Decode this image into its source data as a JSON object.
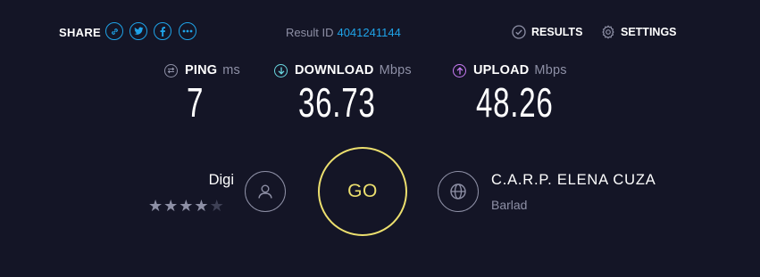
{
  "header": {
    "share_label": "SHARE",
    "share_icons": [
      {
        "icon": "link-icon",
        "glyph": "⛓"
      },
      {
        "icon": "twitter-icon",
        "glyph": "t"
      },
      {
        "icon": "facebook-icon",
        "glyph": "f"
      },
      {
        "icon": "more-icon",
        "glyph": "•••"
      }
    ],
    "result_id_label": "Result ID",
    "result_id_value": "4041241144",
    "results_label": "RESULTS",
    "settings_label": "SETTINGS"
  },
  "metrics": {
    "ping": {
      "label": "PING",
      "unit": "ms",
      "value": "7",
      "icon": "ping-icon"
    },
    "download": {
      "label": "DOWNLOAD",
      "unit": "Mbps",
      "value": "36.73",
      "icon": "download-arrow-icon"
    },
    "upload": {
      "label": "UPLOAD",
      "unit": "Mbps",
      "value": "48.26",
      "icon": "upload-arrow-icon"
    }
  },
  "isp": {
    "name": "Digi",
    "rating": 4,
    "rating_max": 5
  },
  "go_label": "GO",
  "server": {
    "name": "C.A.R.P. ELENA CUZA",
    "location": "Barlad"
  },
  "colors": {
    "background": "#141526",
    "accent_blue": "#1fa3e8",
    "download_cyan": "#6ad7e0",
    "upload_purple": "#c77bf2",
    "go_yellow": "#ecdf6e",
    "muted": "#8e90a6"
  }
}
